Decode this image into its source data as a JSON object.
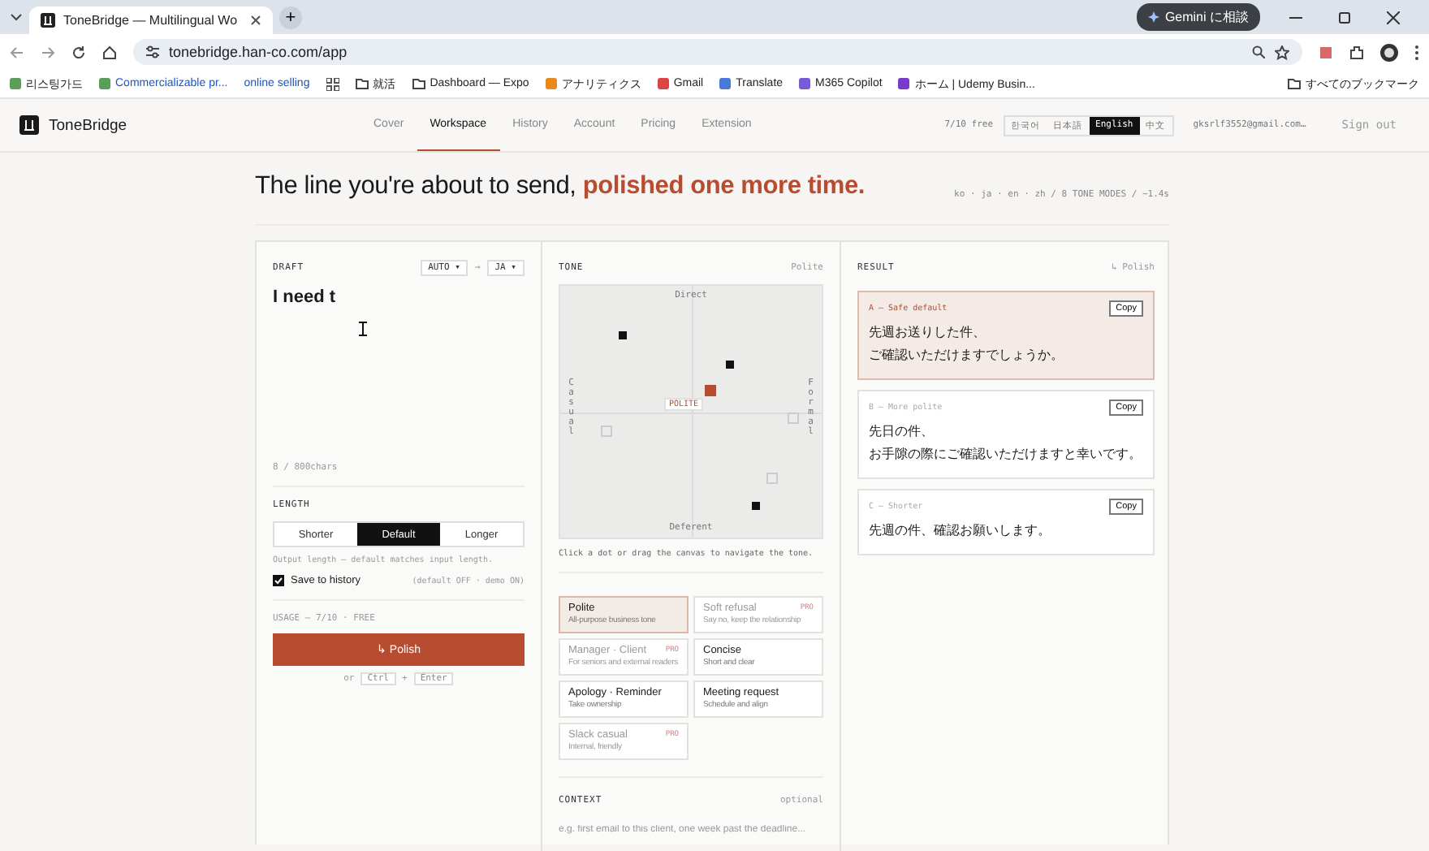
{
  "browser": {
    "tabs": [
      {
        "title": "ToneBridge — Multilingual Wo",
        "selected": true
      }
    ],
    "new_tab": "+",
    "assistant_button": "Gemini に相談",
    "url": "tonebridge.han-co.com/app",
    "bookmarks": [
      {
        "label": "리스팅가드"
      },
      {
        "label": "Commercializable pr..."
      },
      {
        "label": "online selling"
      },
      {
        "label": "就活"
      },
      {
        "label": "Dashboard — Expo"
      },
      {
        "label": "アナリティクス"
      },
      {
        "label": "Gmail"
      },
      {
        "label": "Translate"
      },
      {
        "label": "M365 Copilot"
      },
      {
        "label": "ホーム | Udemy Busin..."
      }
    ],
    "all_bookmarks": "すべてのブックマーク"
  },
  "nav": {
    "brand": "ToneBridge",
    "items": [
      {
        "label": "Cover",
        "selected": false
      },
      {
        "label": "Workspace",
        "selected": true
      },
      {
        "label": "History",
        "selected": false
      },
      {
        "label": "Account",
        "selected": false
      },
      {
        "label": "Pricing",
        "selected": false
      },
      {
        "label": "Extension",
        "selected": false
      }
    ],
    "usage": "7/10 free",
    "languages": [
      {
        "label": "한국어",
        "selected": false
      },
      {
        "label": "日本語",
        "selected": false
      },
      {
        "label": "English",
        "selected": true
      },
      {
        "label": "中文",
        "selected": false
      }
    ],
    "email": "gksrlf3552@gmail.com…",
    "sign_out": "Sign out"
  },
  "hero": {
    "headline": "The line you're about to send,",
    "headline_accent": "polished one more time.",
    "meta": "ko · ja · en · zh / 8 TONE MODES / ~1.4s"
  },
  "draft": {
    "label": "DRAFT",
    "source_language": "AUTO ▾",
    "arrow": "→",
    "target_language": "JA ▾",
    "value": "I need t",
    "char_count": "8 / 800chars",
    "length_label": "LENGTH",
    "length_options": [
      {
        "label": "Shorter",
        "selected": false
      },
      {
        "label": "Default",
        "selected": true
      },
      {
        "label": "Longer",
        "selected": false
      }
    ],
    "length_hint": "Output length — default matches input length.",
    "save_history": {
      "label": "Save to history",
      "checked": true
    },
    "save_note": "(default OFF · demo ON)",
    "usage": "USAGE — 7/10 · FREE",
    "polish_button": "↳ Polish",
    "shortcut": {
      "prefix": "or",
      "key_1": "Ctrl",
      "plus": "+",
      "key_2": "Enter"
    }
  },
  "tone": {
    "label": "TONE",
    "current": "Polite",
    "axis_top": "Direct",
    "axis_bottom": "Deferent",
    "axis_left": "Casual",
    "axis_right": "Formal",
    "marker_label": "POLITE",
    "hint": "Click a dot or drag the canvas to navigate the tone.",
    "modes": [
      {
        "name": "Polite",
        "description": "All-purpose business tone",
        "selected": true,
        "pro": false
      },
      {
        "name": "Soft refusal",
        "description": "Say no, keep the relationship",
        "selected": false,
        "pro": true,
        "badge": "PRO"
      },
      {
        "name": "Manager · Client",
        "description": "For seniors and external readers",
        "selected": false,
        "pro": true,
        "badge": "PRO"
      },
      {
        "name": "Concise",
        "description": "Short and clear",
        "selected": false,
        "pro": false
      },
      {
        "name": "Apology · Reminder",
        "description": "Take ownership",
        "selected": false,
        "pro": false
      },
      {
        "name": "Meeting request",
        "description": "Schedule and align",
        "selected": false,
        "pro": false
      },
      {
        "name": "Slack casual",
        "description": "Internal, friendly",
        "selected": false,
        "pro": true,
        "badge": "PRO"
      }
    ],
    "context_label": "CONTEXT",
    "context_optional": "optional",
    "context_placeholder": "e.g. first email to this client, one week past the deadline..."
  },
  "result": {
    "label": "RESULT",
    "action": "↳ Polish",
    "items": [
      {
        "title": "A — Safe default",
        "lines": [
          "先週お送りした件、",
          "ご確認いただけますでしょうか。"
        ],
        "copy": "Copy",
        "selected": true
      },
      {
        "title": "B — More polite",
        "lines": [
          "先日の件、",
          "お手隙の際にご確認いただけますと幸いです。"
        ],
        "copy": "Copy",
        "selected": false
      },
      {
        "title": "C — Shorter",
        "lines": [
          "先週の件、確認お願いします。"
        ],
        "copy": "Copy",
        "selected": false
      }
    ]
  }
}
